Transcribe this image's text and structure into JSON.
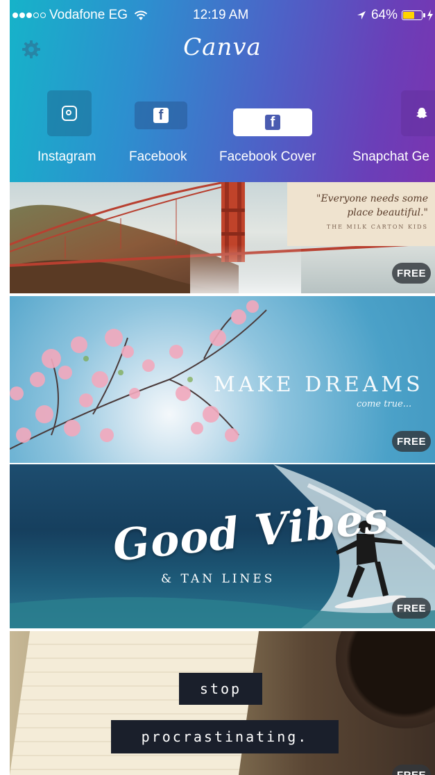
{
  "status_bar": {
    "carrier": "Vodafone EG",
    "time": "12:19 AM",
    "battery": "64%",
    "battery_level": 0.64,
    "signal_bars": 3
  },
  "header": {
    "logo": "Canva",
    "settings_icon": "gear-icon"
  },
  "categories": [
    {
      "label": "Instagram",
      "icon": "instagram-icon"
    },
    {
      "label": "Facebook",
      "icon": "facebook-icon"
    },
    {
      "label": "Facebook Cover",
      "icon": "facebook-icon"
    },
    {
      "label": "Snapchat Ge",
      "icon": "snapchat-icon"
    }
  ],
  "templates": [
    {
      "quote": "\"Everyone needs some place beautiful.\"",
      "author": "THE MILK CARTON KIDS",
      "badge": "FREE"
    },
    {
      "title": "MAKE  DREAMS",
      "subtitle": "come true...",
      "badge": "FREE"
    },
    {
      "title": "Good Vibes",
      "subtitle": "& TAN LINES",
      "badge": "FREE"
    },
    {
      "line1": "stop",
      "line2": "procrastinating.",
      "badge": "FREE"
    }
  ],
  "colors": {
    "header_gradient_start": "#16b3c9",
    "header_gradient_end": "#7a34b0",
    "battery": "#ffd400",
    "free_badge": "#32373c"
  }
}
